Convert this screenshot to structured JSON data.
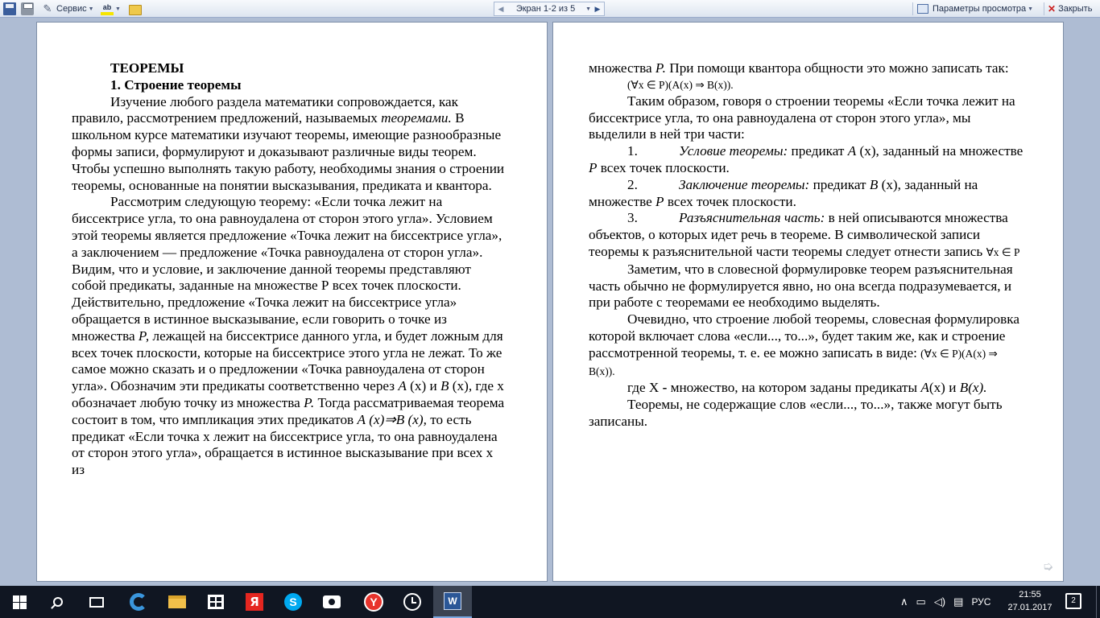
{
  "toolbar": {
    "tools_label": "Сервис",
    "highlight_icon_text": "ab",
    "pager_text": "Экран 1-2 из 5",
    "view_params_label": "Параметры просмотра",
    "close_label": "Закрыть"
  },
  "left_page": {
    "heading1": "ТЕОРЕМЫ",
    "heading2": "1. Строение теоремы",
    "p1_a": "Изучение любого раздела математики сопровождается, как правило, рассмотрением предложений, называемых ",
    "p1_em": "теоремами.",
    "p1_b": " В школьном курсе математики изучают теоремы, имеющие разнообразные формы записи, формулируют и доказывают различные виды теорем. Чтобы успешно выполнять такую работу, необходимы знания о строении теоремы, основанные на понятии высказывания, предиката и квантора.",
    "p2_a": "Рассмотрим следующую теорему: «Если точка лежит на биссектрисе угла, то она равноудалена от сторон этого угла». Условием этой теоремы является предложение «Точка лежит на биссектрисе угла», а заключением — предложение «Точка равноудалена от сторон угла». Видим, что и условие, и заключение данной теоремы представляют собой предикаты, заданные на множестве Р всех точек плоскости. Действительно, предложение «Точка лежит на биссектрисе угла» обращается в истинное высказывание, если говорить о точке из множества ",
    "p2_P1": "Р,",
    "p2_b": " лежащей на биссектрисе данного угла, и будет ложным для всех точек плоскости, которые на биссектрисе этого угла не лежат. То же самое можно сказать и о предложении «Точка равноудалена от сторон угла». Обозначим эти предикаты соответственно через ",
    "p2_A": "А",
    "p2_c": " (х) и ",
    "p2_B": "В",
    "p2_d": " (х), где х обозначает любую точку из множества ",
    "p2_P2": "Р.",
    "p2_e": " Тогда рассматриваемая теорема состоит в том, что импликация этих предикатов ",
    "p2_impl": "А (х)⇒В (х),",
    "p2_f": " то есть предикат «Если точка х лежит на биссектрисе угла, то она равноудалена от сторон этого угла», обращается в истинное высказывание при всех х из"
  },
  "right_page": {
    "r1_a": "множества ",
    "r1_P": "Р.",
    "r1_b": " При помощи квантора общности это можно записать так:",
    "formula1": "(∀x ∈ P)(A(x) ⇒ B(x)).",
    "r2": "Таким образом, говоря о строении теоремы «Если точка лежит на биссектрисе угла, то она равноудалена от сторон этого угла», мы выделили в ней три части:",
    "item1_num": "1.",
    "item1_em": "Условие теоремы:",
    "item1_a": " предикат ",
    "item1_A": "А",
    "item1_b": " (х), заданный на множестве ",
    "item1_P": "Р",
    "item1_c": " всех точек плоскости.",
    "item2_num": "2.",
    "item2_em": "Заключение теоремы:",
    "item2_a": " предикат ",
    "item2_B": "В",
    "item2_b": " (х), заданный на множестве ",
    "item2_P": "Р",
    "item2_c": " всех точек плоскости.",
    "item3_num": "3.",
    "item3_em": "Разъяснительная часть:",
    "item3_a": " в ней описываются множества объектов, о которых идет речь в теореме. В символической записи теоремы к разъяснительной части теоремы следует отнести запись ",
    "item3_formula": "∀x ∈ P",
    "r3": "Заметим, что в словесной формулировке теорем разъяснительная часть обычно не формулируется явно, но она всегда подразумевается, и при работе с теоремами ее необходимо выделять.",
    "r4_a": "Очевидно, что строение любой теоремы, словесная формулировка которой включает слова «если..., то...», будет таким же, как и строение рассмотренной теоремы, т. е. ее можно записать в виде: ",
    "formula2": "(∀x ∈ P)(A(x) ⇒ B(x)).",
    "r5_a": "где X ",
    "r5_dash": "-",
    "r5_b": " множество, на котором заданы предикаты ",
    "r5_A": "А",
    "r5_c": "(х) и ",
    "r5_B": "В(х).",
    "r6": "Теоремы, не содержащие слов «если..., то...», также могут быть записаны."
  },
  "taskbar": {
    "yandex_letter": "Я",
    "skype_letter": "S",
    "ybrowser_letter": "Y",
    "word_letter": "W",
    "language": "РУС",
    "time": "21:55",
    "date": "27.01.2017",
    "notification_count": "2"
  },
  "colors": {
    "background": "#aebcd3",
    "toolbar": "#dde5f0",
    "taskbar": "#101622",
    "word_blue": "#2b5797"
  }
}
